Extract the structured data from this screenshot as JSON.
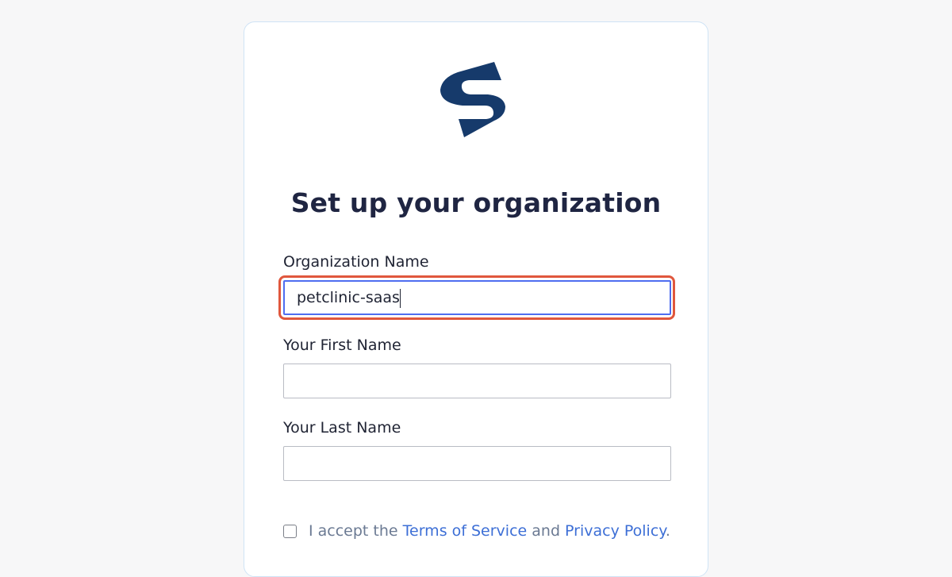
{
  "form": {
    "title": "Set up your organization",
    "fields": [
      {
        "label": "Organization Name",
        "value": "petclinic-saas",
        "placeholder": ""
      },
      {
        "label": "Your First Name",
        "value": "",
        "placeholder": ""
      },
      {
        "label": "Your Last Name",
        "value": "",
        "placeholder": ""
      }
    ],
    "terms": {
      "prefix": "I accept the ",
      "terms_link": "Terms of Service",
      "middle": " and ",
      "privacy_link": "Privacy Policy",
      "suffix": "."
    },
    "accept_checked": false
  },
  "colors": {
    "brand": "#163a6b",
    "title": "#1f2542",
    "focus_highlight": "#e0573d",
    "link": "#3d6fd6"
  },
  "icons": {
    "logo": "brand-s-logo-icon"
  }
}
